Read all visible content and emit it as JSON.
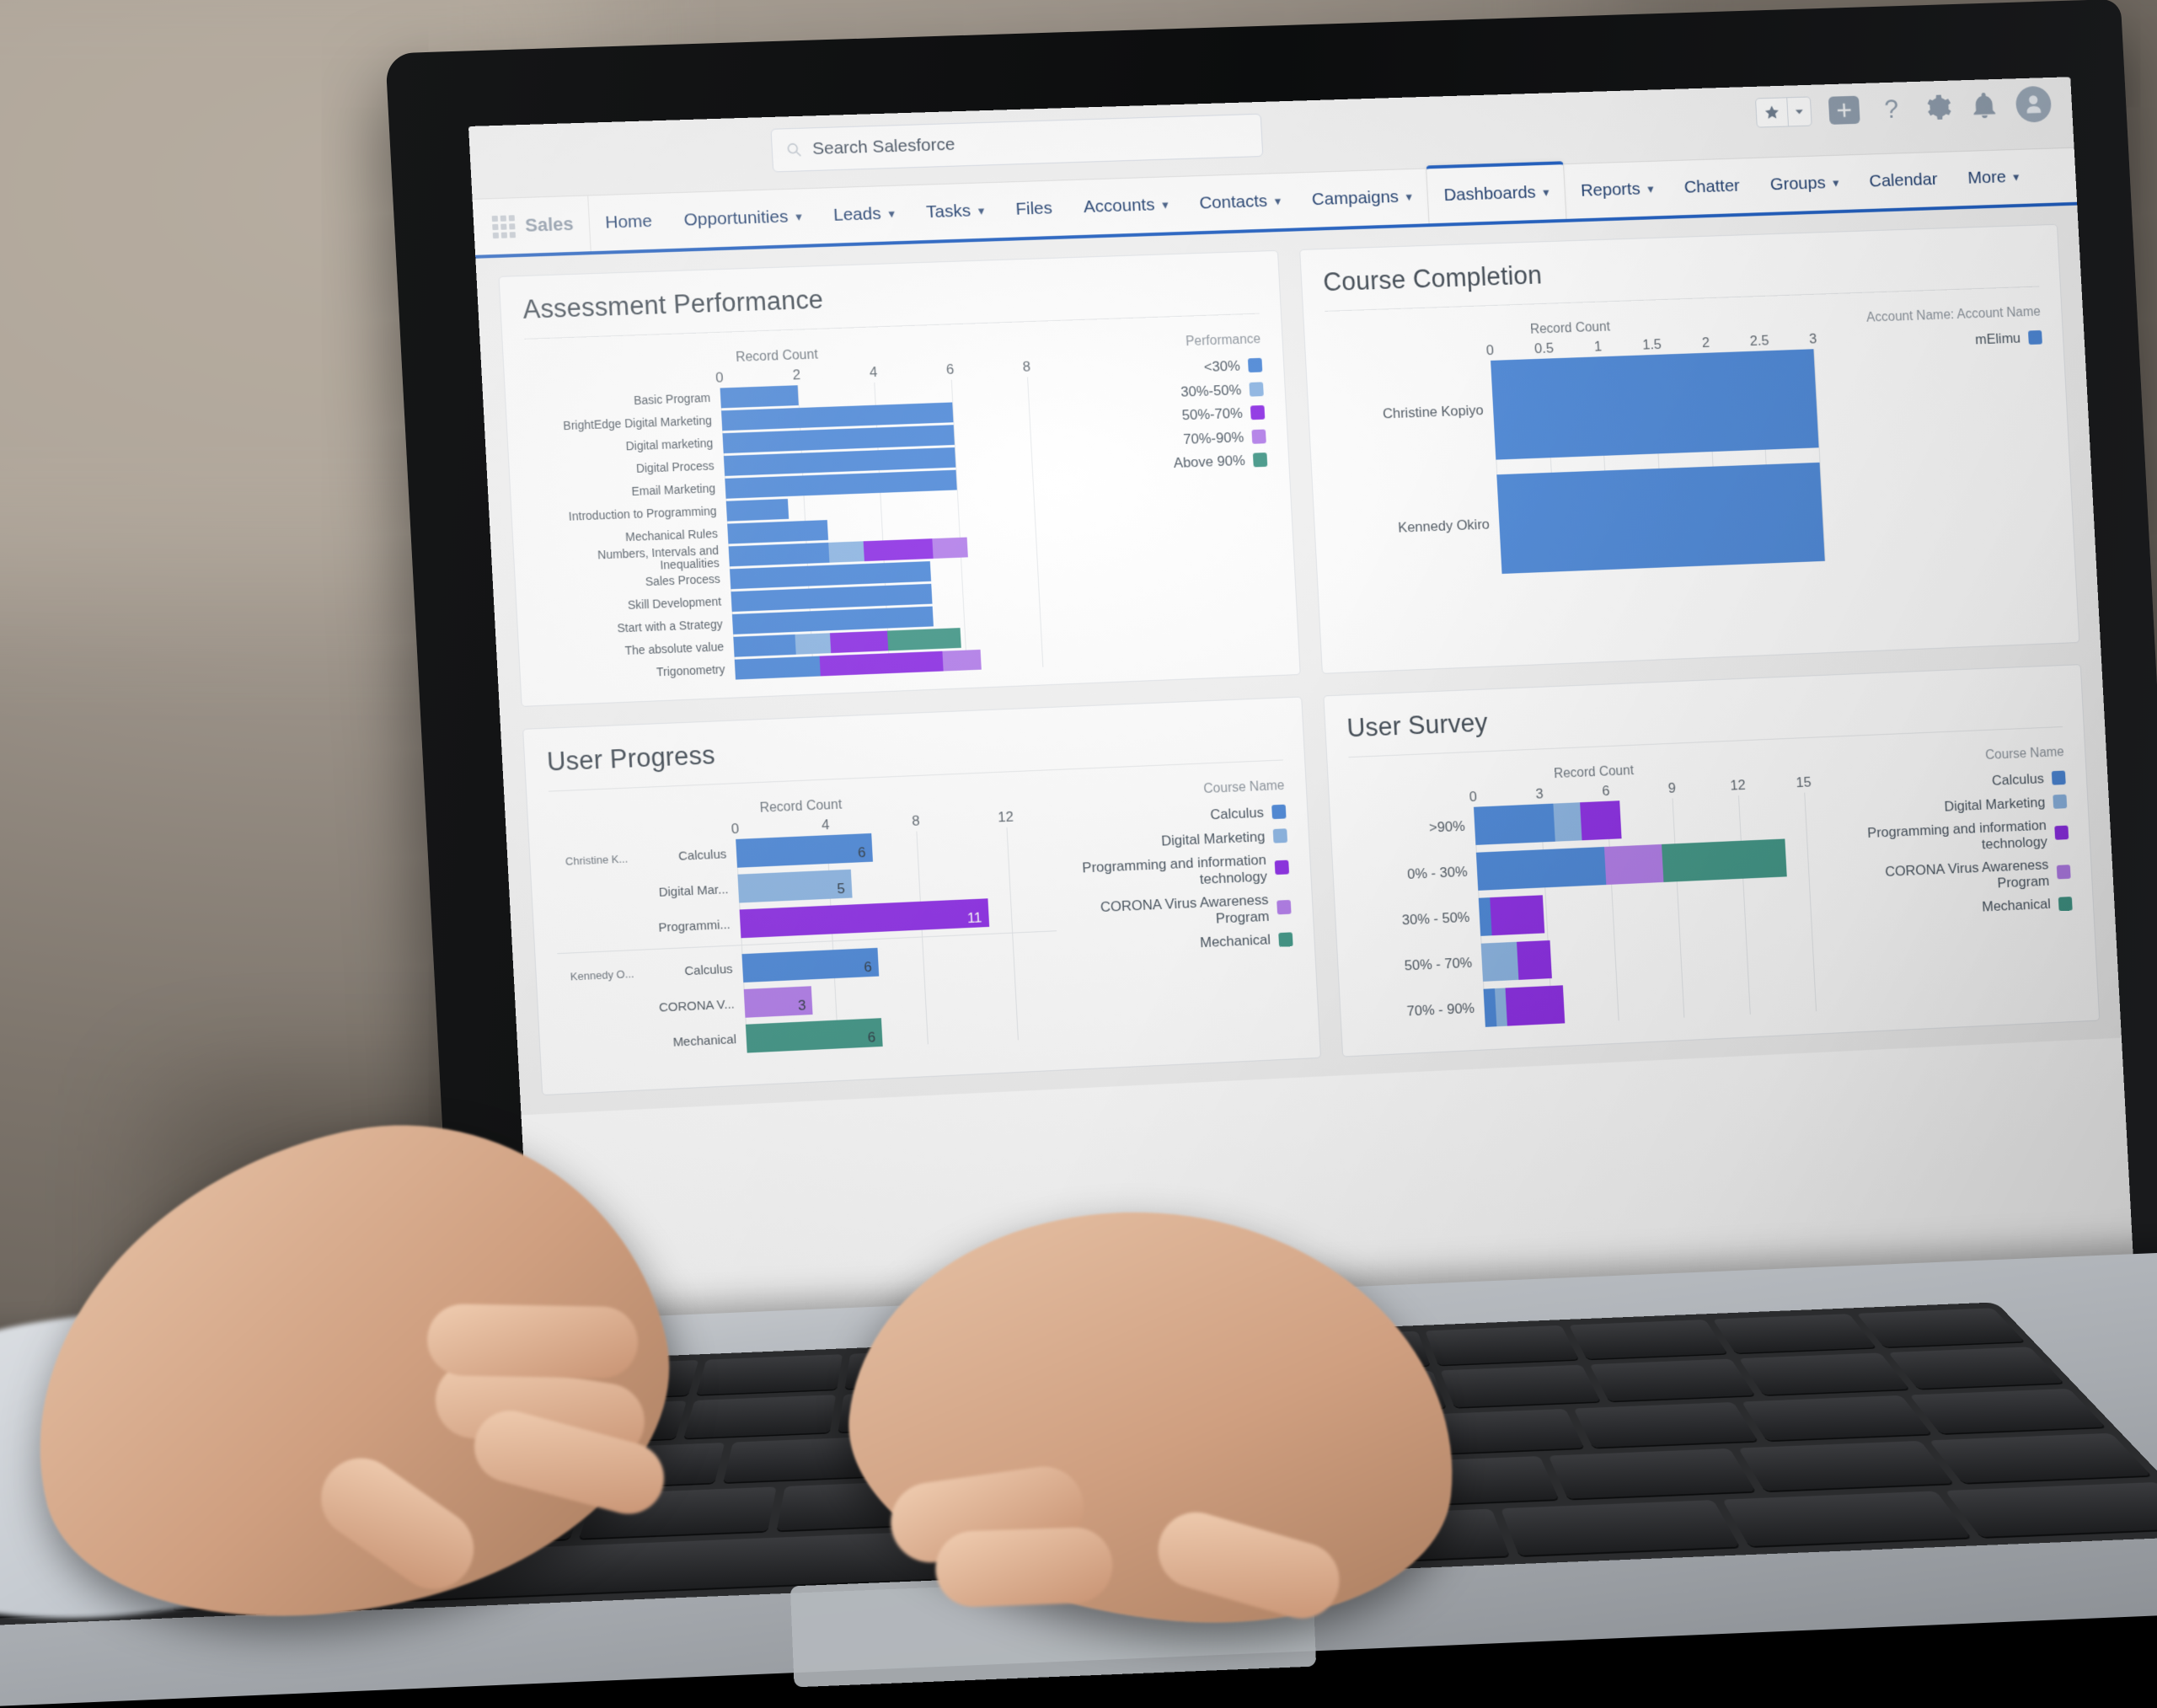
{
  "app": {
    "logo": "salesforce-cloud-logo",
    "app_launcher": "app-launcher-waffle",
    "app_name": "Sales"
  },
  "search": {
    "placeholder": "Search Salesforce",
    "value": "",
    "icon": "search-icon"
  },
  "header_icons": [
    {
      "name": "favorites-star-icon",
      "glyph": "star"
    },
    {
      "name": "favorites-dropdown-icon",
      "glyph": "caret-down"
    },
    {
      "name": "global-actions-plus-icon",
      "glyph": "plus"
    },
    {
      "name": "help-icon",
      "glyph": "question"
    },
    {
      "name": "setup-gear-icon",
      "glyph": "gear"
    },
    {
      "name": "notifications-bell-icon",
      "glyph": "bell"
    },
    {
      "name": "user-avatar",
      "glyph": "person"
    }
  ],
  "nav": {
    "items": [
      {
        "label": "Home",
        "caret": false,
        "active": false
      },
      {
        "label": "Opportunities",
        "caret": true,
        "active": false
      },
      {
        "label": "Leads",
        "caret": true,
        "active": false
      },
      {
        "label": "Tasks",
        "caret": true,
        "active": false
      },
      {
        "label": "Files",
        "caret": false,
        "active": false
      },
      {
        "label": "Accounts",
        "caret": true,
        "active": false
      },
      {
        "label": "Contacts",
        "caret": true,
        "active": false
      },
      {
        "label": "Campaigns",
        "caret": true,
        "active": false
      },
      {
        "label": "Dashboards",
        "caret": true,
        "active": true
      },
      {
        "label": "Reports",
        "caret": true,
        "active": false
      },
      {
        "label": "Chatter",
        "caret": false,
        "active": false
      },
      {
        "label": "Groups",
        "caret": true,
        "active": false
      },
      {
        "label": "Calendar",
        "caret": false,
        "active": false
      },
      {
        "label": "More",
        "caret": true,
        "active": false
      }
    ],
    "accent_color": "#1b5bbf"
  },
  "palette": {
    "calculus": "#4a86d6",
    "digital_marketing": "#8bb4e2",
    "programming": "#8a2be2",
    "corona": "#b07be8",
    "mechanical": "#3f9585",
    "perf_lt30": "#4a86d6",
    "perf_30_50": "#8bb4e2",
    "perf_50_70": "#8a2be2",
    "perf_70_90": "#b07be8",
    "perf_above90": "#3f9585"
  },
  "chart_data": [
    {
      "id": "assessment-performance",
      "type": "bar",
      "stacked": true,
      "title": "Assessment Performance",
      "xlabel": "Record Count",
      "ylabel": "",
      "xticks": [
        0,
        2,
        4,
        6,
        8
      ],
      "xlim": [
        0,
        8
      ],
      "legend_title": "Performance",
      "legend_position": "right",
      "grid": true,
      "series": [
        {
          "name": "<30%",
          "color": "#4a86d6",
          "values": [
            2,
            6,
            6,
            6,
            6,
            1.6,
            2.6,
            2.6,
            5.2,
            5.2,
            5.2,
            1.6,
            2.2
          ]
        },
        {
          "name": "30%-50%",
          "color": "#8bb4e2",
          "values": [
            0,
            0,
            0,
            0,
            0,
            0,
            0,
            0.9,
            0,
            0,
            0,
            0.9,
            0
          ]
        },
        {
          "name": "50%-70%",
          "color": "#8a2be2",
          "values": [
            0,
            0,
            0,
            0,
            0,
            0,
            0,
            1.8,
            0,
            0,
            0,
            1.5,
            3.2
          ]
        },
        {
          "name": "70%-90%",
          "color": "#b07be8",
          "values": [
            0,
            0,
            0,
            0,
            0,
            0,
            0,
            0.9,
            0,
            0,
            0,
            0,
            1
          ]
        },
        {
          "name": "Above 90%",
          "color": "#3f9585",
          "values": [
            0,
            0,
            0,
            0,
            0,
            0,
            0,
            0,
            0,
            0,
            0,
            1.9,
            0
          ]
        }
      ],
      "categories": [
        "Basic Program",
        "BrightEdge Digital Marketing",
        "Digital marketing",
        "Digital Process",
        "Email Marketing",
        "Introduction to Programming",
        "Mechanical Rules",
        "Numbers, Intervals and Inequalities",
        "Sales Process",
        "Skill Development",
        "Start with a Strategy",
        "The absolute value",
        "Trigonometry"
      ]
    },
    {
      "id": "course-completion",
      "type": "bar",
      "stacked": false,
      "title": "Course Completion",
      "xlabel": "Record Count",
      "xticks": [
        0,
        0.5,
        1,
        1.5,
        2,
        2.5,
        3
      ],
      "xlim": [
        0,
        3
      ],
      "legend_title": "Account Name: Account Name",
      "legend_position": "right",
      "grid": true,
      "categories": [
        "Christine Kopiyo",
        "Kennedy Okiro"
      ],
      "series": [
        {
          "name": "mElimu",
          "color": "#4a86d6",
          "values": [
            3,
            3
          ]
        }
      ]
    },
    {
      "id": "user-progress",
      "type": "bar",
      "stacked": false,
      "title": "User Progress",
      "xlabel": "Record Count",
      "xticks": [
        0,
        4,
        8,
        12
      ],
      "xlim": [
        0,
        14
      ],
      "legend_title": "Course Name",
      "legend_position": "right",
      "grid": true,
      "groups": [
        {
          "name": "Christine K...",
          "rows": [
            {
              "label": "Calculus",
              "value": 6,
              "color": "#4a86d6",
              "series": "Calculus"
            },
            {
              "label": "Digital Mar...",
              "value": 5,
              "color": "#8bb4e2",
              "series": "Digital Marketing"
            },
            {
              "label": "Programmi...",
              "value": 11,
              "color": "#8a2be2",
              "series": "Programming and information technology"
            }
          ]
        },
        {
          "name": "Kennedy O...",
          "rows": [
            {
              "label": "Calculus",
              "value": 6,
              "color": "#4a86d6",
              "series": "Calculus"
            },
            {
              "label": "CORONA V...",
              "value": 3,
              "color": "#b07be8",
              "series": "CORONA Virus Awareness Program"
            },
            {
              "label": "Mechanical",
              "value": 6,
              "color": "#3f9585",
              "series": "Mechanical"
            }
          ]
        }
      ],
      "legend": [
        {
          "name": "Calculus",
          "color": "#4a86d6"
        },
        {
          "name": "Digital Marketing",
          "color": "#8bb4e2"
        },
        {
          "name": "Programming and information technology",
          "color": "#8a2be2"
        },
        {
          "name": "CORONA Virus Awareness Program",
          "color": "#b07be8"
        },
        {
          "name": "Mechanical",
          "color": "#3f9585"
        }
      ]
    },
    {
      "id": "user-survey",
      "type": "bar",
      "stacked": true,
      "title": "User Survey",
      "xlabel": "Record Count",
      "xticks": [
        0,
        3,
        6,
        9,
        12,
        15
      ],
      "xlim": [
        0,
        16.5
      ],
      "legend_title": "Course Name",
      "legend_position": "right",
      "grid": true,
      "categories": [
        ">90%",
        "0% - 30%",
        "30% - 50%",
        "50% - 70%",
        "70% - 90%"
      ],
      "series": [
        {
          "name": "Calculus",
          "color": "#4a86d6",
          "values": [
            3.6,
            5.8,
            0.5,
            0,
            0.5
          ]
        },
        {
          "name": "Digital Marketing",
          "color": "#8bb4e2",
          "values": [
            1.2,
            0,
            0,
            1.6,
            0.5
          ]
        },
        {
          "name": "Programming and information technology",
          "color": "#8a2be2",
          "values": [
            1.8,
            0,
            2.4,
            1.5,
            2.6
          ]
        },
        {
          "name": "CORONA Virus Awareness Program",
          "color": "#b07be8",
          "values": [
            0,
            2.6,
            0,
            0,
            0
          ]
        },
        {
          "name": "Mechanical",
          "color": "#3f9585",
          "values": [
            0,
            5.6,
            0,
            0,
            0
          ]
        }
      ]
    }
  ]
}
